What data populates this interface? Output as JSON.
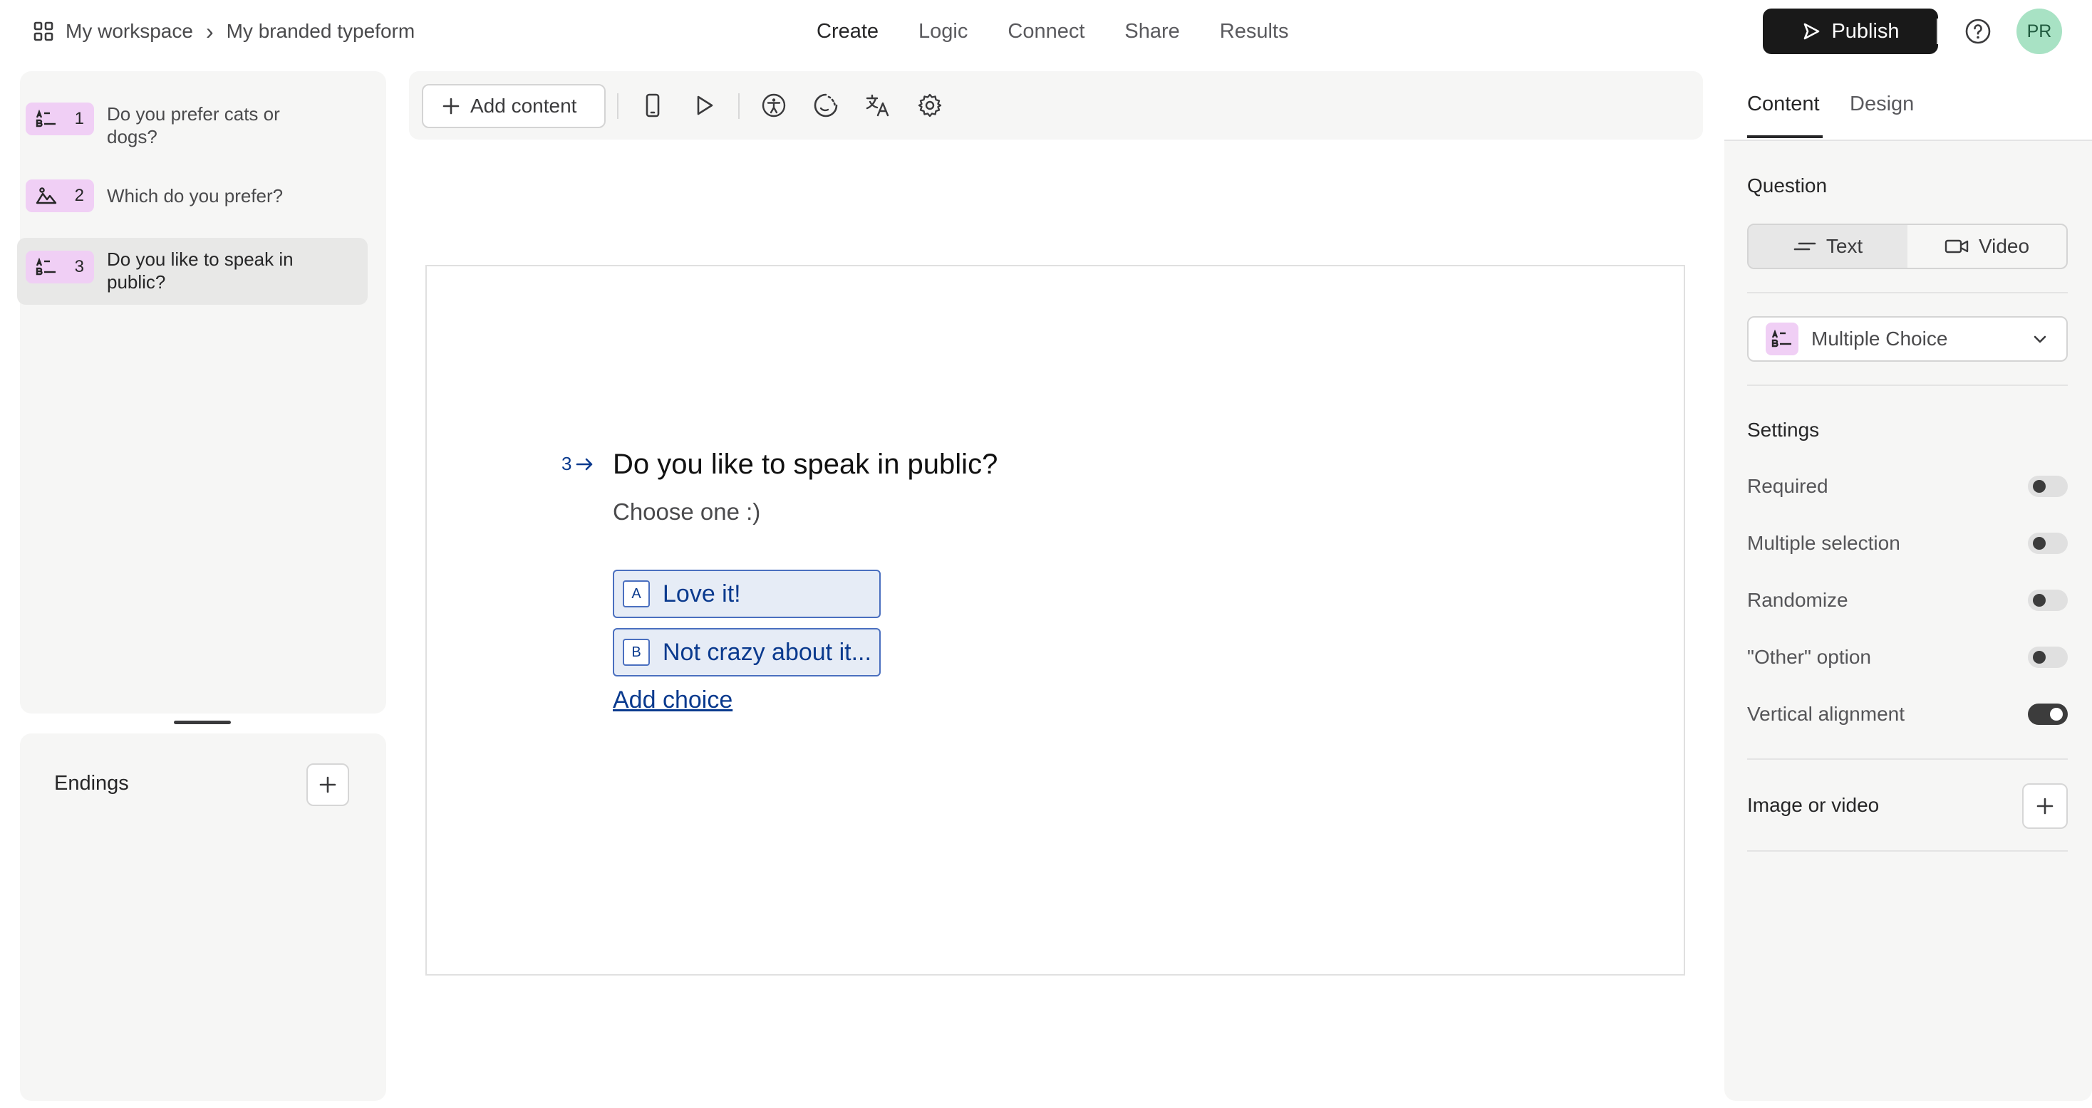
{
  "breadcrumb": {
    "workspace": "My workspace",
    "separator": "›",
    "form": "My branded typeform"
  },
  "nav": {
    "create": "Create",
    "logic": "Logic",
    "connect": "Connect",
    "share": "Share",
    "results": "Results"
  },
  "header": {
    "publish": "Publish",
    "avatar": "PR"
  },
  "sidebar": {
    "questions": [
      {
        "number": "1",
        "label": "Do you prefer cats or dogs?",
        "icon": "multiple-choice-icon"
      },
      {
        "number": "2",
        "label": "Which do you prefer?",
        "icon": "picture-choice-icon"
      },
      {
        "number": "3",
        "label": "Do you like to speak in public?",
        "icon": "multiple-choice-icon"
      }
    ],
    "endings_label": "Endings"
  },
  "toolbar": {
    "add_content": "Add content"
  },
  "question": {
    "number": "3",
    "title": "Do you like to speak in public?",
    "subtitle": "Choose one :)",
    "choices": [
      {
        "key": "A",
        "label": "Love it!"
      },
      {
        "key": "B",
        "label": "Not crazy about it..."
      }
    ],
    "add_choice": "Add choice"
  },
  "panel": {
    "tabs": {
      "content": "Content",
      "design": "Design"
    },
    "question_label": "Question",
    "question_types": {
      "text": "Text",
      "video": "Video"
    },
    "type_select": "Multiple Choice",
    "settings_label": "Settings",
    "settings": [
      {
        "label": "Required",
        "on": false
      },
      {
        "label": "Multiple selection",
        "on": false
      },
      {
        "label": "Randomize",
        "on": false
      },
      {
        "label": "\"Other\" option",
        "on": false
      },
      {
        "label": "Vertical alignment",
        "on": true
      }
    ],
    "image_video_label": "Image or video"
  },
  "colors": {
    "accent_blue": "#0a3a8e",
    "choice_bg": "#e6ecf6",
    "badge_pink": "#f0cff5",
    "avatar_green": "#a8e2c4",
    "publish_bg": "#191919"
  }
}
